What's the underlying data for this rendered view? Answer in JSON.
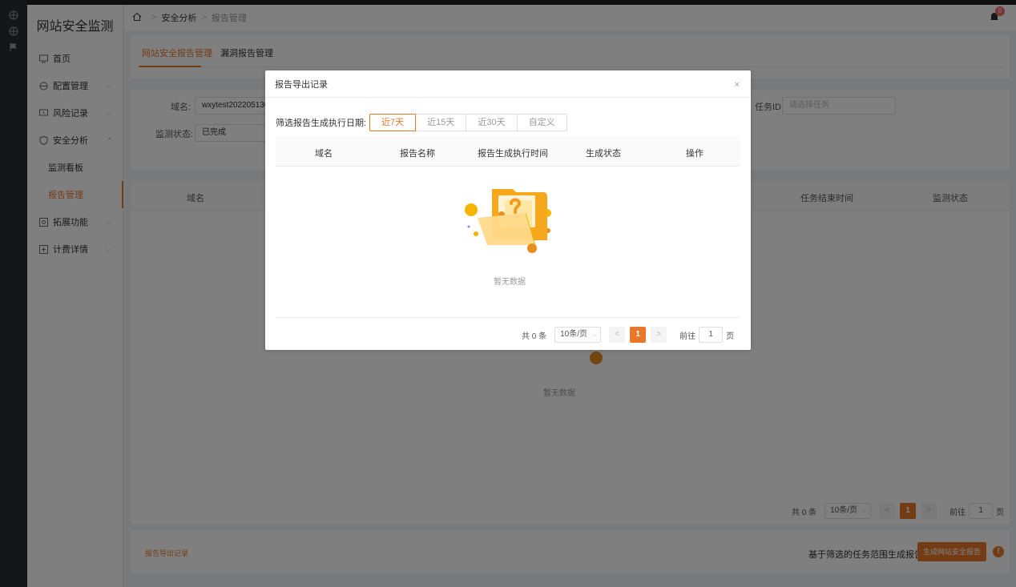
{
  "app": {
    "title": "网站安全监测"
  },
  "sidebar": {
    "items": [
      {
        "label": "首页"
      },
      {
        "label": "配置管理"
      },
      {
        "label": "风险记录"
      },
      {
        "label": "安全分析"
      },
      {
        "label": "监测看板"
      },
      {
        "label": "报告管理"
      },
      {
        "label": "拓展功能"
      },
      {
        "label": "计费详情"
      }
    ]
  },
  "header": {
    "breadcrumb": [
      "安全分析",
      "报告管理"
    ],
    "notification_count": "0"
  },
  "tabs": [
    "网站安全报告管理",
    "漏洞报告管理"
  ],
  "filters": {
    "domain_label": "域名:",
    "domain_value": "wxytest2022051300",
    "task_id_label": "任务ID:",
    "task_id_placeholder": "请选择任务",
    "status_label": "监测状态:",
    "status_value": "已完成"
  },
  "table": {
    "columns": [
      "域名",
      "任务结束时间",
      "监测状态"
    ],
    "empty_text": "暂无数据"
  },
  "pagination": {
    "total_text": "共 0 条",
    "page_size": "10条/页",
    "current_page": "1",
    "goto_label": "前往",
    "goto_value": "1",
    "page_suffix": "页",
    "prev": "<",
    "next": ">"
  },
  "bottom": {
    "export_link": "报告导出记录",
    "generate_label": "基于筛选的任务范围生成报告:",
    "generate_button": "生成网站安全报告",
    "warn_icon": "!"
  },
  "modal": {
    "title": "报告导出记录",
    "close": "×",
    "filter_label": "筛选报告生成执行日期:",
    "ranges": [
      "近7天",
      "近15天",
      "近30天",
      "自定义"
    ],
    "active_range": "近7天",
    "columns": [
      "域名",
      "报告名称",
      "报告生成执行时间",
      "生成状态",
      "操作"
    ],
    "empty_text": "暂无数据",
    "pagination": {
      "total_text": "共 0 条",
      "page_size": "10条/页",
      "current_page": "1",
      "goto_label": "前往",
      "goto_value": "1",
      "page_suffix": "页",
      "prev": "<",
      "next": ">"
    }
  },
  "colors": {
    "accent": "#e9782a",
    "overlay": "rgba(0,0,0,0.5)"
  }
}
